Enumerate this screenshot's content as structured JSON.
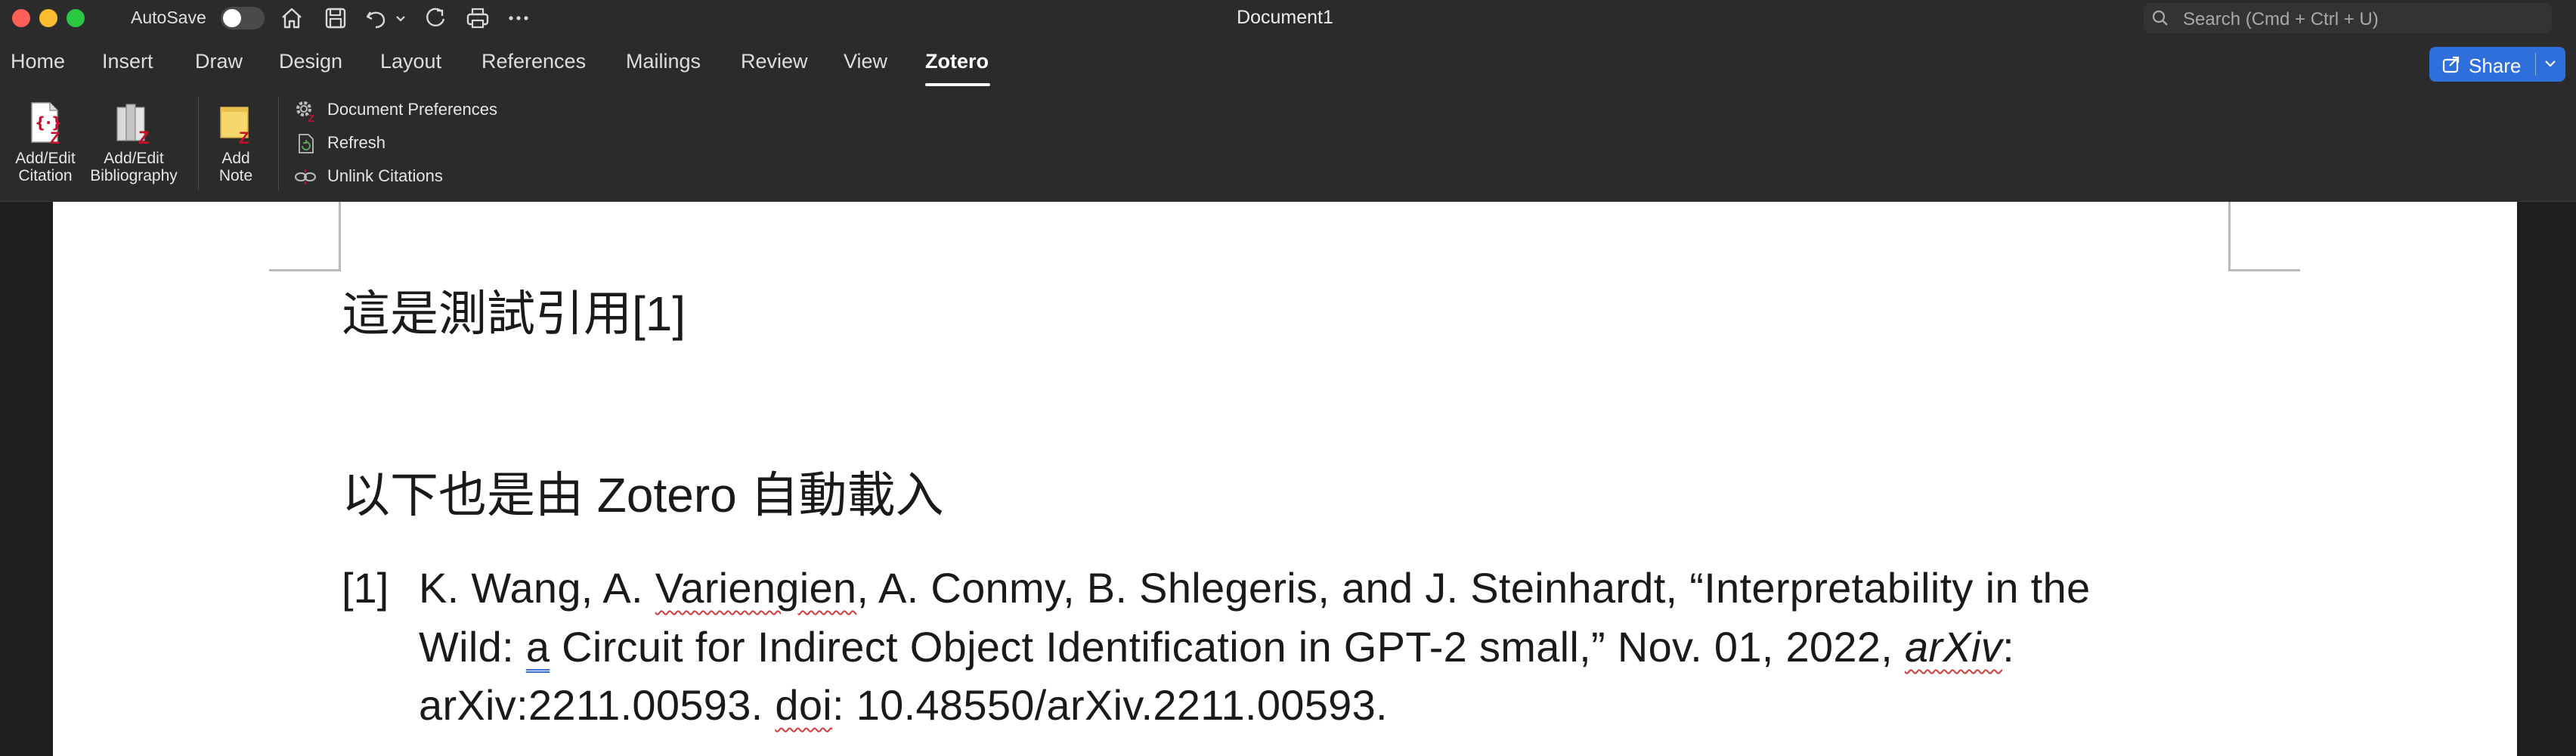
{
  "titlebar": {
    "autosave_label": "AutoSave",
    "doc_title": "Document1",
    "search_placeholder": "Search (Cmd + Ctrl + U)"
  },
  "tabs": [
    "Home",
    "Insert",
    "Draw",
    "Design",
    "Layout",
    "References",
    "Mailings",
    "Review",
    "View",
    "Zotero"
  ],
  "active_tab": "Zotero",
  "share": {
    "label": "Share"
  },
  "ribbon": {
    "add_citation": [
      "Add/Edit",
      "Citation"
    ],
    "add_bibliography": [
      "Add/Edit",
      "Bibliography"
    ],
    "add_note": [
      "Add",
      "Note"
    ],
    "document_preferences": "Document Preferences",
    "refresh": "Refresh",
    "unlink": "Unlink Citations"
  },
  "document": {
    "line1": "這是測試引用[1]",
    "line2": "以下也是由 Zotero 自動載入",
    "bibliography": {
      "num": "[1]",
      "l1_a": "K. Wang, A. ",
      "l1_b": "Variengien",
      "l1_c": ", A. Conmy, B. Shlegeris, and J. Steinhardt, “Interpretability in the",
      "l2_a": "Wild: ",
      "l2_b": "a",
      "l2_c": " Circuit for Indirect Object Identification in GPT-2 small,” Nov. 01, 2022, ",
      "l2_d": "arXiv",
      "l2_e": ":",
      "l3_a": "arXiv:2211.00593. ",
      "l3_b": "doi",
      "l3_c": ": 10.48550/arXiv.2211.00593."
    }
  },
  "colors": {
    "chrome": "#2b2b2b",
    "share_blue": "#2f6fdb",
    "page": "#ffffff",
    "zotero_red": "#c8102e"
  }
}
